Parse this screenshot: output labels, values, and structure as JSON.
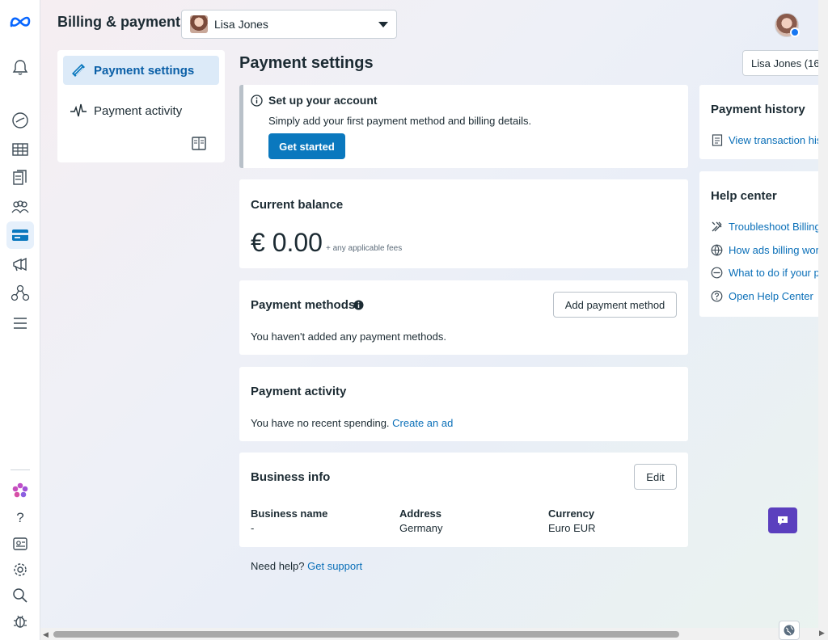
{
  "app": {
    "title": "Billing & payments"
  },
  "account_selector": {
    "name": "Lisa Jones"
  },
  "account_pill": "Lisa Jones (16",
  "nav": {
    "items": [
      {
        "label": "Payment settings",
        "active": true
      },
      {
        "label": "Payment activity",
        "active": false
      }
    ]
  },
  "main": {
    "heading": "Payment settings",
    "setup": {
      "title": "Set up your account",
      "text": "Simply add your first payment method and billing details.",
      "button": "Get started"
    },
    "balance": {
      "title": "Current balance",
      "amount": "€ 0.00",
      "note": "+ any applicable fees"
    },
    "payment_methods": {
      "title": "Payment methods",
      "button": "Add payment method",
      "empty": "You haven't added any payment methods."
    },
    "payment_activity": {
      "title": "Payment activity",
      "text": "You have no recent spending.",
      "link": "Create an ad"
    },
    "business_info": {
      "title": "Business info",
      "edit": "Edit",
      "fields": [
        {
          "label": "Business name",
          "value": "-"
        },
        {
          "label": "Address",
          "value": "Germany"
        },
        {
          "label": "Currency",
          "value": "Euro EUR"
        }
      ]
    },
    "help": {
      "text": "Need help?",
      "link": "Get support"
    }
  },
  "right": {
    "payment_history": {
      "title": "Payment history",
      "link": "View transaction his"
    },
    "help_center": {
      "title": "Help center",
      "links": [
        "Troubleshoot Billing",
        "How ads billing wor",
        "What to do if your p",
        "Open Help Center"
      ]
    }
  },
  "colors": {
    "accent": "#0a78be",
    "link": "#0a6fb8",
    "fab": "#5b3fbe"
  }
}
